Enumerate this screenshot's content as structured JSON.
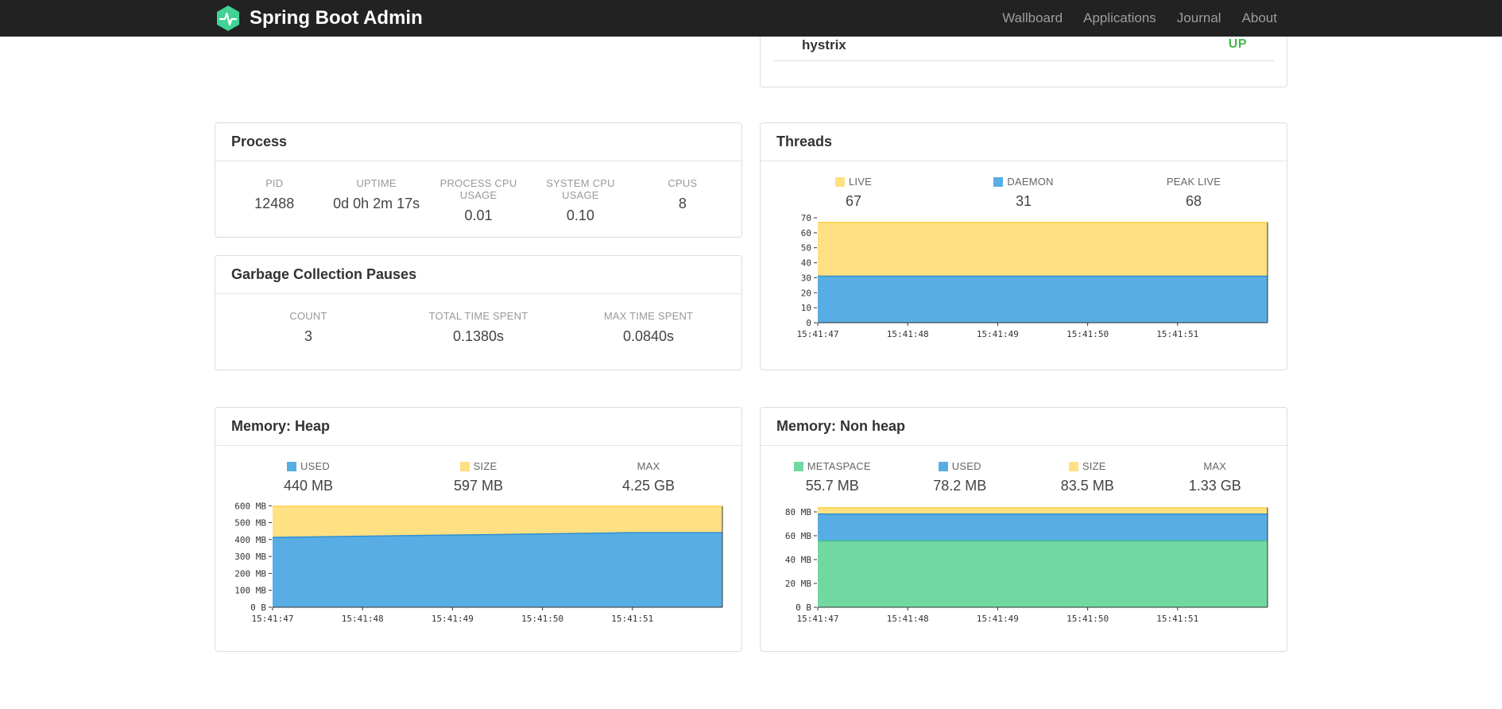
{
  "navbar": {
    "brand": "Spring Boot Admin",
    "items": [
      {
        "label": "Wallboard"
      },
      {
        "label": "Applications"
      },
      {
        "label": "Journal"
      },
      {
        "label": "About"
      }
    ]
  },
  "colors": {
    "navbar_bg": "#222222",
    "status_up_green": "#44b749",
    "live_yellow": "#ffe082",
    "daemon_blue": "#58ade4",
    "metaspace_green": "#72d8a2"
  },
  "application": {
    "name": "hystrix",
    "status": "UP"
  },
  "process": {
    "title": "Process",
    "metrics": [
      {
        "label": "PID",
        "value": "12488"
      },
      {
        "label": "UPTIME",
        "value": "0d 0h 2m 17s"
      },
      {
        "label": "PROCESS CPU USAGE",
        "value": "0.01"
      },
      {
        "label": "SYSTEM CPU USAGE",
        "value": "0.10"
      },
      {
        "label": "CPUS",
        "value": "8"
      }
    ]
  },
  "gc": {
    "title": "Garbage Collection Pauses",
    "metrics": [
      {
        "label": "COUNT",
        "value": "3"
      },
      {
        "label": "TOTAL TIME SPENT",
        "value": "0.1380s"
      },
      {
        "label": "MAX TIME SPENT",
        "value": "0.0840s"
      }
    ]
  },
  "threads": {
    "title": "Threads",
    "legend": [
      {
        "label": "LIVE",
        "value": "67",
        "swatch": "#ffe082"
      },
      {
        "label": "DAEMON",
        "value": "31",
        "swatch": "#58ade4"
      },
      {
        "label": "PEAK LIVE",
        "value": "68",
        "swatch": null
      }
    ]
  },
  "heap": {
    "title": "Memory: Heap",
    "legend": [
      {
        "label": "USED",
        "value": "440 MB",
        "swatch": "#58ade4"
      },
      {
        "label": "SIZE",
        "value": "597 MB",
        "swatch": "#ffe082"
      },
      {
        "label": "MAX",
        "value": "4.25 GB",
        "swatch": null
      }
    ]
  },
  "nonheap": {
    "title": "Memory: Non heap",
    "legend": [
      {
        "label": "METASPACE",
        "value": "55.7 MB",
        "swatch": "#72d8a2"
      },
      {
        "label": "USED",
        "value": "78.2 MB",
        "swatch": "#58ade4"
      },
      {
        "label": "SIZE",
        "value": "83.5 MB",
        "swatch": "#ffe082"
      },
      {
        "label": "MAX",
        "value": "1.33 GB",
        "swatch": null
      }
    ]
  },
  "chart_data": [
    {
      "id": "threads-chart",
      "type": "area",
      "title": "Threads",
      "xlabel": "",
      "ylabel": "",
      "x": [
        "15:41:47",
        "15:41:48",
        "15:41:49",
        "15:41:50",
        "15:41:51"
      ],
      "ylim": [
        0,
        70
      ],
      "yticks": [
        {
          "v": 0,
          "label": "0"
        },
        {
          "v": 10,
          "label": "10"
        },
        {
          "v": 20,
          "label": "20"
        },
        {
          "v": 30,
          "label": "30"
        },
        {
          "v": 40,
          "label": "40"
        },
        {
          "v": 50,
          "label": "50"
        },
        {
          "v": 60,
          "label": "60"
        },
        {
          "v": 70,
          "label": "70"
        }
      ],
      "series": [
        {
          "name": "LIVE",
          "fill": "#ffe082",
          "stroke": "#fbd34e",
          "values": [
            67,
            67,
            67,
            67,
            67
          ]
        },
        {
          "name": "DAEMON",
          "fill": "#58ade4",
          "stroke": "#2f8fd1",
          "values": [
            31,
            31,
            31,
            31,
            31
          ]
        }
      ]
    },
    {
      "id": "heap-chart",
      "type": "area",
      "title": "Memory: Heap",
      "xlabel": "",
      "ylabel": "",
      "x": [
        "15:41:47",
        "15:41:48",
        "15:41:49",
        "15:41:50",
        "15:41:51"
      ],
      "ylim": [
        0,
        620
      ],
      "yticks": [
        {
          "v": 0,
          "label": "0 B"
        },
        {
          "v": 100,
          "label": "100 MB"
        },
        {
          "v": 200,
          "label": "200 MB"
        },
        {
          "v": 300,
          "label": "300 MB"
        },
        {
          "v": 400,
          "label": "400 MB"
        },
        {
          "v": 500,
          "label": "500 MB"
        },
        {
          "v": 600,
          "label": "600 MB"
        }
      ],
      "series": [
        {
          "name": "SIZE",
          "fill": "#ffe082",
          "stroke": "#fbd34e",
          "values": [
            597,
            597,
            597,
            597,
            597
          ]
        },
        {
          "name": "USED",
          "fill": "#58ade4",
          "stroke": "#2f8fd1",
          "values": [
            413,
            420,
            427,
            433,
            441
          ]
        }
      ]
    },
    {
      "id": "nonheap-chart",
      "type": "area",
      "title": "Memory: Non heap",
      "xlabel": "",
      "ylabel": "",
      "x": [
        "15:41:47",
        "15:41:48",
        "15:41:49",
        "15:41:50",
        "15:41:51"
      ],
      "ylim": [
        0,
        88
      ],
      "yticks": [
        {
          "v": 0,
          "label": "0 B"
        },
        {
          "v": 20,
          "label": "20 MB"
        },
        {
          "v": 40,
          "label": "40 MB"
        },
        {
          "v": 60,
          "label": "60 MB"
        },
        {
          "v": 80,
          "label": "80 MB"
        }
      ],
      "series": [
        {
          "name": "SIZE",
          "fill": "#ffe082",
          "stroke": "#fbd34e",
          "values": [
            83.5,
            83.5,
            83.5,
            83.5,
            83.5
          ]
        },
        {
          "name": "USED",
          "fill": "#58ade4",
          "stroke": "#2f8fd1",
          "values": [
            78.2,
            78.2,
            78.2,
            78.2,
            78.2
          ]
        },
        {
          "name": "METASPACE",
          "fill": "#72d8a2",
          "stroke": "#43c189",
          "values": [
            55.7,
            55.7,
            55.7,
            55.7,
            55.7
          ]
        }
      ]
    }
  ]
}
